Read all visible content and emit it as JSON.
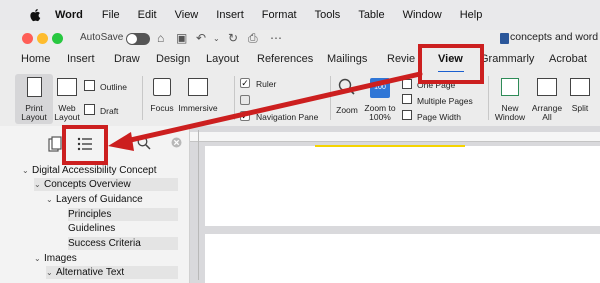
{
  "menubar": {
    "app": "Word",
    "items": [
      "File",
      "Edit",
      "View",
      "Insert",
      "Format",
      "Tools",
      "Table",
      "Window",
      "Help"
    ]
  },
  "titlebar": {
    "autosave_label": "AutoSave",
    "document_title": "concepts and word"
  },
  "ribbon": {
    "tabs": [
      "Home",
      "Insert",
      "Draw",
      "Design",
      "Layout",
      "References",
      "Mailings",
      "Revie",
      "View",
      "Grammarly",
      "Acrobat"
    ],
    "active_tab": "View",
    "buttons": {
      "print_layout": "Print Layout",
      "web_layout": "Web Layout",
      "outline": "Outline",
      "draft": "Draft",
      "focus": "Focus",
      "immersive": "Immersive",
      "ruler": "Ruler",
      "navigation_pane": "Navigation Pane",
      "zoom": "Zoom",
      "zoom_100": "Zoom to 100%",
      "zoom_100_icon_text": "100",
      "one_page": "One Page",
      "multiple_pages": "Multiple Pages",
      "page_width": "Page Width",
      "new_window": "New Window",
      "arrange_all": "Arrange All",
      "split": "Split"
    },
    "checks": {
      "ruler": true,
      "navigation_pane": true
    }
  },
  "navigation": {
    "headings": [
      {
        "label": "Digital Accessibility Concept",
        "level": 0,
        "expanded": true
      },
      {
        "label": "Concepts Overview",
        "level": 1,
        "expanded": true
      },
      {
        "label": "Layers of Guidance",
        "level": 2,
        "expanded": true
      },
      {
        "label": "Principles",
        "level": 3
      },
      {
        "label": "Guidelines",
        "level": 3
      },
      {
        "label": "Success Criteria",
        "level": 3
      },
      {
        "label": "Images",
        "level": 1,
        "expanded": true
      },
      {
        "label": "Alternative Text",
        "level": 2,
        "expanded": true
      }
    ]
  },
  "colors": {
    "annotation": "#cc1f1f",
    "accent": "#1a5fd0"
  },
  "icons": [
    "apple-icon",
    "pages-icon",
    "headings-icon",
    "search-icon",
    "close-icon"
  ]
}
